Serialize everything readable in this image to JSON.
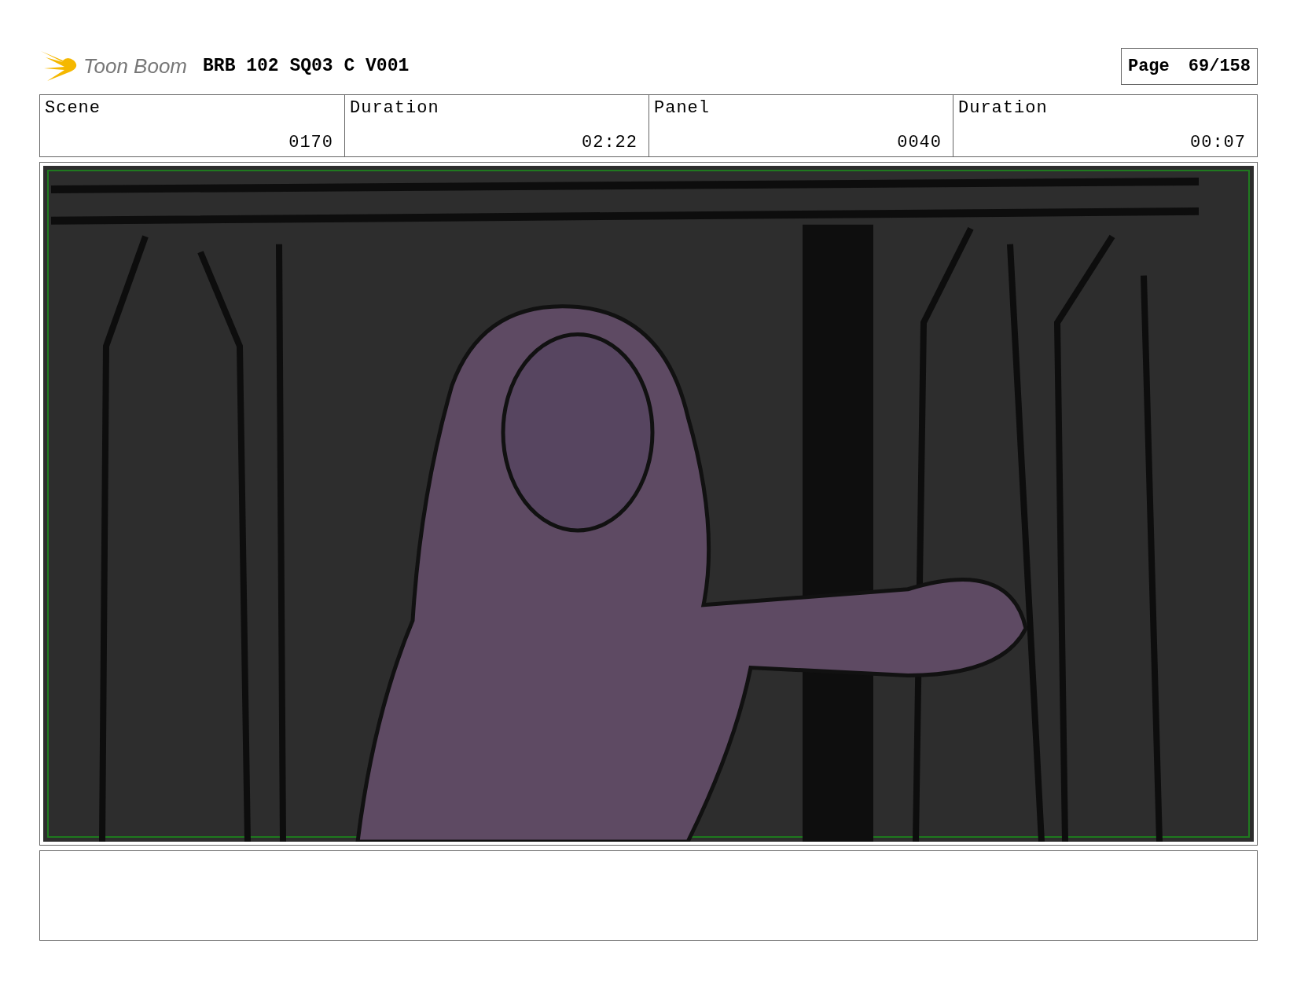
{
  "header": {
    "logo": "Toon Boom",
    "title": "BRB 102 SQ03 C V001",
    "page_label": "Page",
    "page_number": "69/158"
  },
  "fields": [
    {
      "label": "Scene",
      "value": "0170"
    },
    {
      "label": "Duration",
      "value": "02:22"
    },
    {
      "label": "Panel",
      "value": "0040"
    },
    {
      "label": "Duration",
      "value": "00:07"
    }
  ]
}
